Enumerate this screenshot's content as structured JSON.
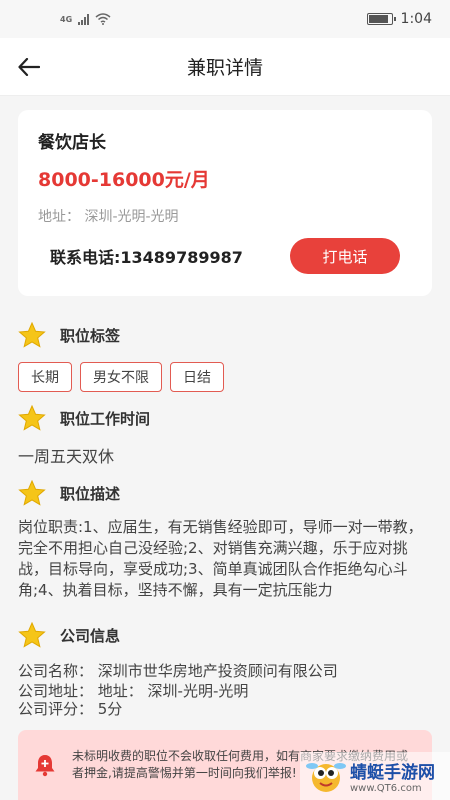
{
  "status_bar": {
    "network": "4G",
    "time": "1:04"
  },
  "nav": {
    "title": "兼职详情",
    "back_icon": "arrow-left-icon"
  },
  "job": {
    "title": "餐饮店长",
    "salary": "8000-16000元/月",
    "address": "地址：  深圳-光明-光明",
    "phone": "联系电话:13489789987",
    "call_label": "打电话"
  },
  "sections": {
    "tags_title": "职位标签",
    "tags": [
      "长期",
      "男女不限",
      "日结"
    ],
    "time_title": "职位工作时间",
    "time_value": "一周五天双休",
    "desc_title": "职位描述",
    "desc_value": "岗位职责:1、应届生，有无销售经验即可，导师一对一带教，完全不用担心自己没经验;2、对销售充满兴趣，乐于应对挑战，目标导向，享受成功;3、简单真诚团队合作拒绝勾心斗角;4、执着目标，坚持不懈，具有一定抗压能力",
    "company_title": "公司信息",
    "company_name": "公司名称：  深圳市世华房地产投资顾问有限公司",
    "company_address": "公司地址：  地址：  深圳-光明-光明",
    "company_rating": "公司评分：  5分"
  },
  "notice": {
    "text": "未标明收费的职位不会收取任何费用，如有商家要求缴纳费用或者押金,请提高警惕并第一时间向我们举报!"
  },
  "watermark": {
    "name": "蜻蜓手游网",
    "url": "www.QT6.com"
  },
  "colors": {
    "accent": "#e8413b",
    "salary": "#e53935",
    "tag_border": "#e25b52",
    "notice_bg": "#ffd9d9",
    "star": "#f5c518"
  }
}
